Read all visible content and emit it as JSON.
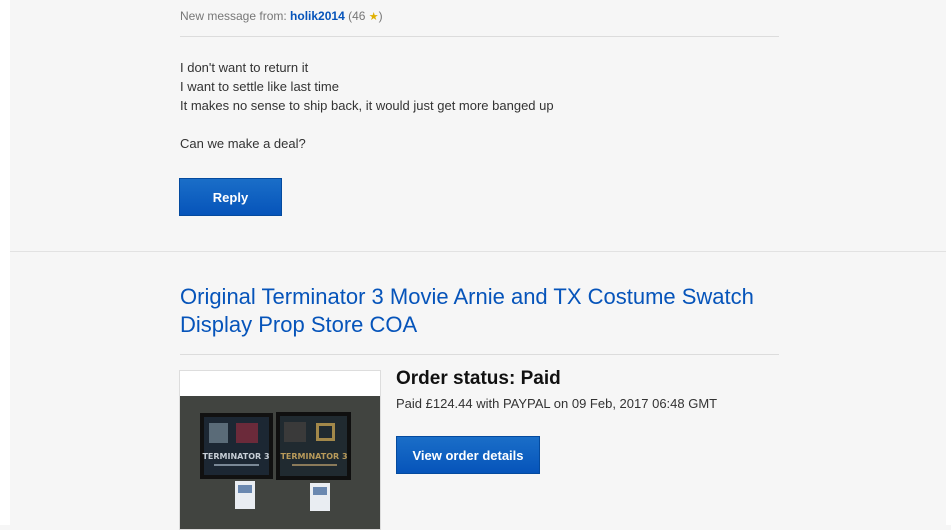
{
  "message": {
    "header_prefix": "New message from:",
    "sender": "holik2014",
    "feedback_open": "(46",
    "feedback_close": ")",
    "lines": [
      "I don't want to return it",
      "I want to settle like last time",
      "It makes no sense to ship back, it would just get more banged up",
      "Can we make a deal?"
    ],
    "reply_label": "Reply"
  },
  "item": {
    "title": "Original Terminator 3 Movie Arnie and TX Costume Swatch Display Prop Store COA",
    "order_status": "Order status: Paid",
    "paid_text": "Paid £124.44 with PAYPAL on 09 Feb, 2017 06:48 GMT",
    "view_order_label": "View order details",
    "image_text": {
      "left_frame_logo": "TERMINATOR 3",
      "right_frame_logo": "TERMINATOR 3"
    }
  },
  "colors": {
    "link": "#0654ba",
    "button": "#0654ba",
    "star": "#e0b000"
  }
}
